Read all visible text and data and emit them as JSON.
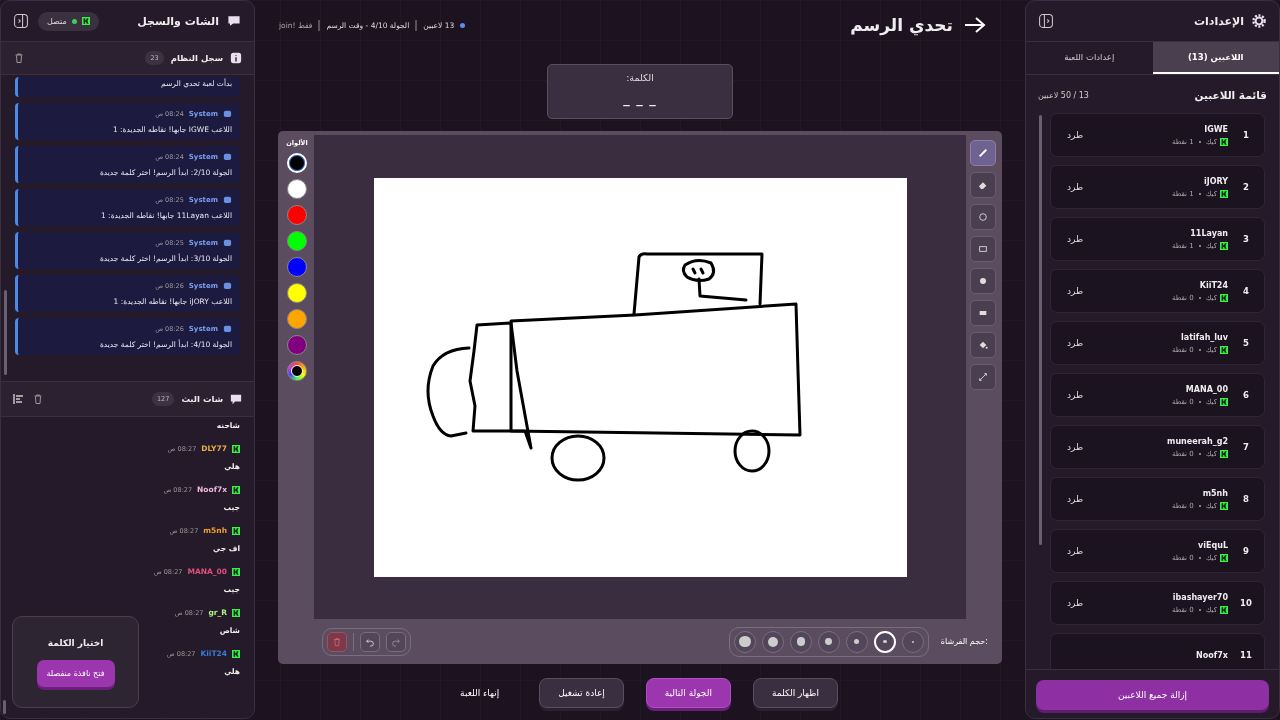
{
  "settings_panel": {
    "title": "الإعدادات",
    "tabs": [
      {
        "label": "اللاعبين (13)",
        "selected": true
      },
      {
        "label": "إعدادات اللعبة",
        "selected": false
      }
    ],
    "list_title": "قائمة اللاعبين",
    "capacity": "13 / 50 لاعبين",
    "players": [
      {
        "rank": "1",
        "name": "IGWE",
        "platform": "كيك",
        "points": "1 نقطة",
        "action": "طرد"
      },
      {
        "rank": "2",
        "name": "iJORY",
        "platform": "كيك",
        "points": "1 نقطة",
        "action": "طرد"
      },
      {
        "rank": "3",
        "name": "11Layan",
        "platform": "كيك",
        "points": "1 نقطة",
        "action": "طرد"
      },
      {
        "rank": "4",
        "name": "KiiT24",
        "platform": "كيك",
        "points": "0 نقطة",
        "action": "طرد"
      },
      {
        "rank": "5",
        "name": "latifah_luv",
        "platform": "كيك",
        "points": "0 نقطة",
        "action": "طرد"
      },
      {
        "rank": "6",
        "name": "MANA_00",
        "platform": "كيك",
        "points": "0 نقطة",
        "action": "طرد"
      },
      {
        "rank": "7",
        "name": "muneerah_g2",
        "platform": "كيك",
        "points": "0 نقطة",
        "action": "طرد"
      },
      {
        "rank": "8",
        "name": "m5nh",
        "platform": "كيك",
        "points": "0 نقطة",
        "action": "طرد"
      },
      {
        "rank": "9",
        "name": "viEquL",
        "platform": "كيك",
        "points": "0 نقطة",
        "action": "طرد"
      },
      {
        "rank": "10",
        "name": "ibashayer70",
        "platform": "كيك",
        "points": "0 نقطة",
        "action": "طرد"
      },
      {
        "rank": "11",
        "name": "Noof7x"
      }
    ],
    "remove_all_button": "إزالة جميع اللاعبين"
  },
  "game": {
    "title": "تحدي الرسم",
    "players_status": "13 لاعبين",
    "round_status": "الجولة 4/10 - وقت الرسم",
    "join_hint": "join! فقط",
    "word_label": "الكلمة:",
    "word": "_ _ _",
    "tools": [
      {
        "kind": "pen",
        "selected": true
      },
      {
        "kind": "eraser",
        "selected": false
      },
      {
        "kind": "circle",
        "selected": false
      },
      {
        "kind": "rect",
        "selected": false
      },
      {
        "kind": "circle-fill",
        "selected": false
      },
      {
        "kind": "rect-fill",
        "selected": false
      },
      {
        "kind": "fill",
        "selected": false
      },
      {
        "kind": "line",
        "selected": false
      }
    ],
    "colors_label": "الألوان",
    "colors": [
      {
        "kind": "swatch",
        "color": "#000000",
        "selected": true
      },
      {
        "kind": "swatch",
        "color": "#ffffff",
        "selected": false
      },
      {
        "kind": "swatch",
        "color": "#ff0000",
        "selected": false
      },
      {
        "kind": "swatch",
        "color": "#00ff00",
        "selected": false
      },
      {
        "kind": "swatch",
        "color": "#0000ff",
        "selected": false
      },
      {
        "kind": "swatch",
        "color": "#ffff00",
        "selected": false
      },
      {
        "kind": "swatch",
        "color": "#ffa500",
        "selected": false
      },
      {
        "kind": "swatch",
        "color": "#800080",
        "selected": false
      },
      {
        "kind": "picker",
        "selected": false
      }
    ],
    "brush_label": "حجم الفرشاة:",
    "brush_sizes": [
      {
        "selected": false
      },
      {
        "selected": true
      },
      {
        "selected": false
      },
      {
        "selected": false
      },
      {
        "selected": false
      },
      {
        "selected": false
      },
      {
        "selected": false
      }
    ],
    "actions": [
      {
        "kind": "secondary",
        "label": "اظهار الكلمة"
      },
      {
        "kind": "primary",
        "label": "الجولة التالية"
      },
      {
        "kind": "secondary",
        "label": "إعادة تشغيل"
      },
      {
        "kind": "text",
        "label": "إنهاء اللعبة"
      }
    ]
  },
  "chat_panel": {
    "title": "الشات والسجل",
    "connection": "متصل",
    "connected": true,
    "log": {
      "title": "سجل النظام",
      "count": "23",
      "entries": [
        {
          "text": "بدأت لعبة تحدي الرسم"
        },
        {
          "source": "System",
          "time": "08:24 ص",
          "text": "اللاعب IGWE جابها! نقاطه الجديدة: 1"
        },
        {
          "source": "System",
          "time": "08:24 ص",
          "text": "الجولة 2/10: ابدأ الرسم! اختر كلمة جديدة"
        },
        {
          "source": "System",
          "time": "08:25 ص",
          "text": "اللاعب 11Layan جابها! نقاطه الجديدة: 1"
        },
        {
          "source": "System",
          "time": "08:25 ص",
          "text": "الجولة 3/10: ابدأ الرسم! اختر كلمة جديدة"
        },
        {
          "source": "System",
          "time": "08:26 ص",
          "text": "اللاعب iJORY جابها! نقاطه الجديدة: 1"
        },
        {
          "source": "System",
          "time": "08:26 ص",
          "text": "الجولة 4/10: ابدأ الرسم! اختر كلمة جديدة"
        }
      ]
    },
    "chat": {
      "title": "شات البث",
      "count": "127",
      "messages": [
        {
          "text": "شاحنه"
        },
        {
          "user": "DLY77",
          "color": "#e8b04a",
          "time": "08:27 ص",
          "text": "هلي"
        },
        {
          "user": "Noof7x",
          "color": "#f0b8e0",
          "time": "08:27 ص",
          "text": "جيب"
        },
        {
          "user": "m5nh",
          "color": "#f0a030",
          "time": "08:27 ص",
          "text": "اف جي"
        },
        {
          "user": "MANA_00",
          "color": "#e0507a",
          "time": "08:27 ص",
          "text": "جيب"
        },
        {
          "user": "gr_R",
          "color": "#b0f080",
          "time": "08:27 ص",
          "text": "شاص"
        },
        {
          "user": "KiiT24",
          "color": "#3a7ad8",
          "time": "08:27 ص",
          "text": "هلي"
        }
      ]
    },
    "word_picker": {
      "title": "اختيار الكلمة",
      "button": "فتح نافذة منفصلة"
    }
  }
}
